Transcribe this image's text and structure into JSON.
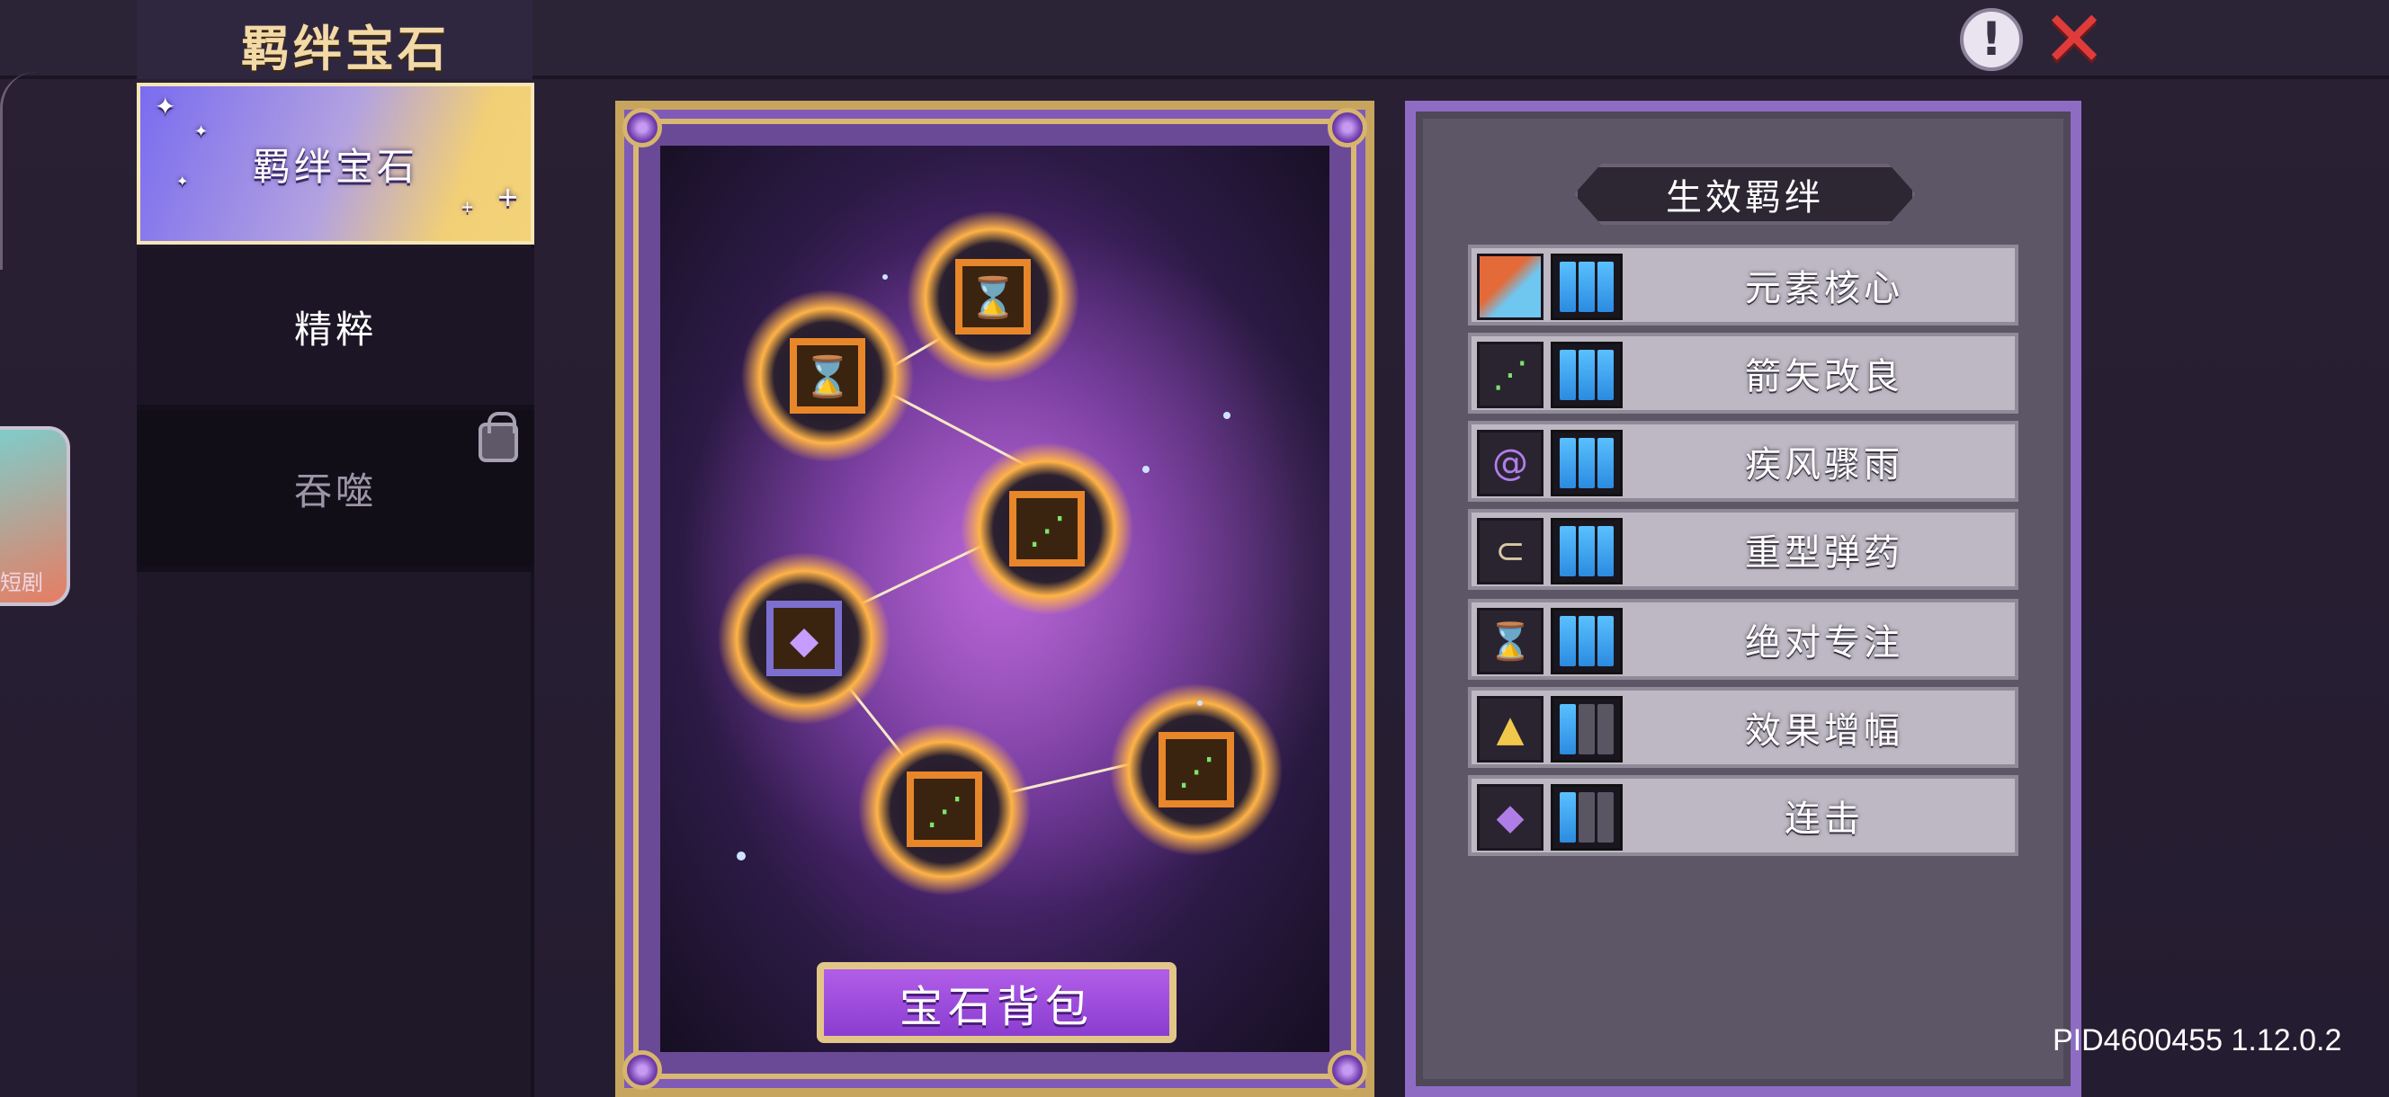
{
  "window": {
    "title": "羁绊宝石"
  },
  "toolbar": {
    "info_icon": "exclamation-icon",
    "close_icon": "close-x-icon"
  },
  "sidebar": {
    "tabs": [
      {
        "label": "羁绊宝石",
        "active": true
      },
      {
        "label": "精粹",
        "active": false
      },
      {
        "label": "吞噬",
        "active": false,
        "locked": true
      }
    ]
  },
  "side_app": {
    "label": "短剧"
  },
  "constellation": {
    "gems": [
      {
        "type": "hourglass",
        "icon": "hourglass-gem-icon"
      },
      {
        "type": "hourglass",
        "icon": "hourglass-gem-icon"
      },
      {
        "type": "arrow-fan",
        "icon": "arrow-fan-gem-icon"
      },
      {
        "type": "crystal",
        "icon": "purple-crystal-gem-icon"
      },
      {
        "type": "arrow-fan",
        "icon": "arrow-fan-gem-icon"
      },
      {
        "type": "arrow-fan",
        "icon": "arrow-fan-gem-icon"
      }
    ],
    "bag_button_label": "宝石背包"
  },
  "bonds": {
    "header": "生效羁绊",
    "items": [
      {
        "name": "元素核心",
        "icon": "element-core-icon",
        "level": 3,
        "max": 3
      },
      {
        "name": "箭矢改良",
        "icon": "arrow-upgrade-icon",
        "level": 3,
        "max": 3
      },
      {
        "name": "疾风骤雨",
        "icon": "whirlwind-icon",
        "level": 3,
        "max": 3
      },
      {
        "name": "重型弹药",
        "icon": "heavy-ammo-icon",
        "level": 3,
        "max": 3
      },
      {
        "name": "绝对专注",
        "icon": "hourglass-icon",
        "level": 3,
        "max": 3
      },
      {
        "name": "效果增幅",
        "icon": "amplify-icon",
        "level": 1,
        "max": 3
      },
      {
        "name": "连击",
        "icon": "combo-crystal-icon",
        "level": 1,
        "max": 3
      }
    ]
  },
  "footer": {
    "version": "PID4600455 1.12.0.2"
  },
  "colors": {
    "active_tab_gradient_start": "#7a6cf0",
    "active_tab_gradient_end": "#f3d37a",
    "pip_on": "#3aa2f0",
    "pip_off": "#595562",
    "close_red": "#e03b3b",
    "panel_border": "#8e6cc4",
    "card_gold": "#c7a55f"
  }
}
